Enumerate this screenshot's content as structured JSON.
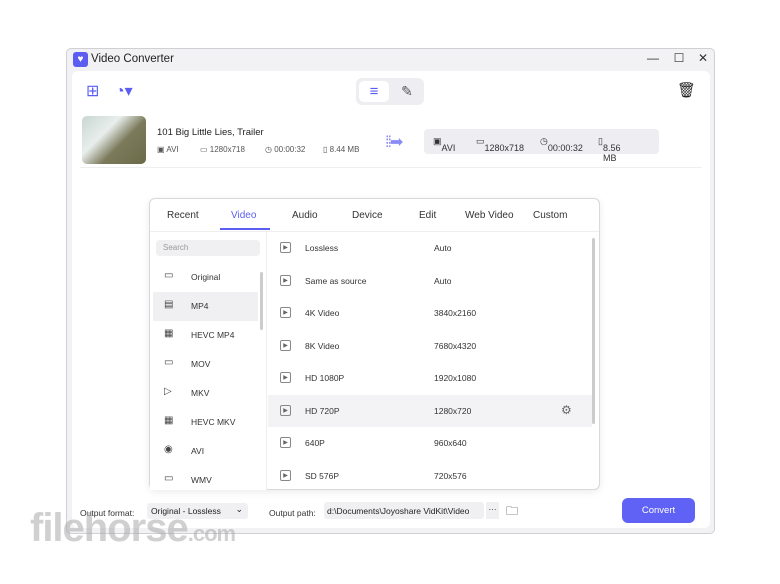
{
  "window": {
    "title": "Video Converter",
    "minimize": "—",
    "maximize": "☐",
    "close": "✕"
  },
  "toolbar": {
    "add_file_icon": "add-video-icon",
    "add_more_icon": "add-disc-icon",
    "list_view_icon": "≡",
    "task_view_icon": "✎",
    "trash_icon": "🗑"
  },
  "file": {
    "name": "101 Big Little Lies, Trailer",
    "format": "AVI",
    "resolution": "1280x718",
    "duration": "00:00:32",
    "size": "8.44 MB"
  },
  "output": {
    "format": "AVI",
    "resolution": "1280x718",
    "duration": "00:00:32",
    "size": "8.56 MB"
  },
  "dialog": {
    "tabs": [
      "Recent",
      "Video",
      "Audio",
      "Device",
      "Edit",
      "Web Video",
      "Custom"
    ],
    "active_tab": "Video",
    "search_placeholder": "Search",
    "formats": [
      {
        "label": "Original",
        "icon": "▭"
      },
      {
        "label": "MP4",
        "icon": "▤"
      },
      {
        "label": "HEVC MP4",
        "icon": "▦"
      },
      {
        "label": "MOV",
        "icon": "▭"
      },
      {
        "label": "MKV",
        "icon": "▷"
      },
      {
        "label": "HEVC MKV",
        "icon": "▦"
      },
      {
        "label": "AVI",
        "icon": "◉"
      },
      {
        "label": "WMV",
        "icon": "▭"
      }
    ],
    "selected_format": "MP4",
    "presets": [
      {
        "name": "Lossless",
        "res": "Auto"
      },
      {
        "name": "Same as source",
        "res": "Auto"
      },
      {
        "name": "4K Video",
        "res": "3840x2160"
      },
      {
        "name": "8K Video",
        "res": "7680x4320"
      },
      {
        "name": "HD 1080P",
        "res": "1920x1080"
      },
      {
        "name": "HD 720P",
        "res": "1280x720"
      },
      {
        "name": "640P",
        "res": "960x640"
      },
      {
        "name": "SD 576P",
        "res": "720x576"
      }
    ],
    "selected_preset": "HD 720P"
  },
  "bottom": {
    "format_label": "Output format:",
    "format_value": "Original - Lossless",
    "path_label": "Output path:",
    "path_value": "d:\\Documents\\Joyoshare VidKit\\Video",
    "more": "···",
    "convert": "Convert"
  },
  "watermark": "filehorse.com",
  "colors": {
    "accent": "#5b5ef0"
  }
}
